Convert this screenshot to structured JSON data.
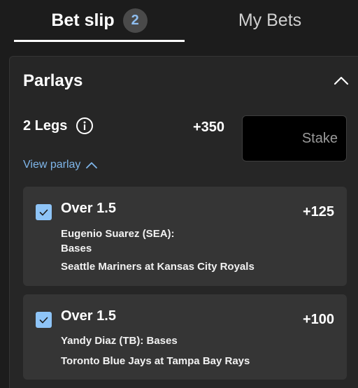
{
  "tabs": {
    "bet_slip": {
      "label": "Bet slip",
      "badge": "2"
    },
    "my_bets": {
      "label": "My Bets"
    }
  },
  "parlay": {
    "title": "Parlays",
    "legs_label": "2 Legs",
    "odds": "+350",
    "stake_placeholder": "Stake",
    "stake_value": "",
    "view_parlay_label": "View parlay"
  },
  "legs": [
    {
      "checked": true,
      "market": "Over 1.5",
      "selection": "Eugenio Suarez (SEA): Bases",
      "event": "Seattle Mariners at Kansas City Royals",
      "odds": "+125"
    },
    {
      "checked": true,
      "market": "Over 1.5",
      "selection": "Yandy Diaz (TB): Bases",
      "event": "Toronto Blue Jays at Tampa Bay Rays",
      "odds": "+100"
    }
  ],
  "colors": {
    "background": "#1c1c1c",
    "card": "#262626",
    "leg_card": "#353535",
    "accent_link": "#7fb6ea",
    "checkbox": "#8ec4f7",
    "badge_bg": "#4a4a4a",
    "badge_text": "#8fbef0"
  }
}
